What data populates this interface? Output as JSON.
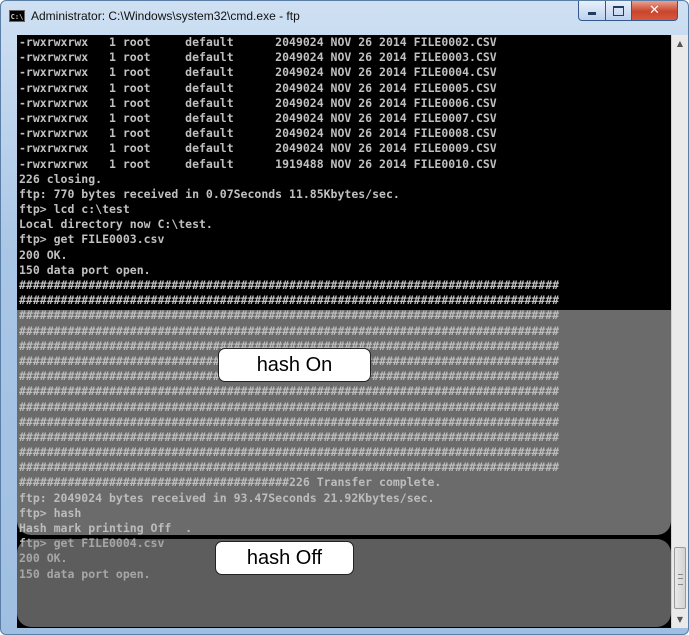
{
  "window": {
    "title": "Administrator: C:\\Windows\\system32\\cmd.exe - ftp",
    "icon": "cmd-icon",
    "controls": {
      "minimize": "minimize-icon",
      "maximize": "maximize-icon",
      "close": "close-icon"
    }
  },
  "console": {
    "text_color": "#c0c0c0",
    "background": "#000000",
    "lines": [
      "-rwxrwxrwx   1 root     default      2049024 NOV 26 2014 FILE0002.CSV",
      "-rwxrwxrwx   1 root     default      2049024 NOV 26 2014 FILE0003.CSV",
      "-rwxrwxrwx   1 root     default      2049024 NOV 26 2014 FILE0004.CSV",
      "-rwxrwxrwx   1 root     default      2049024 NOV 26 2014 FILE0005.CSV",
      "-rwxrwxrwx   1 root     default      2049024 NOV 26 2014 FILE0006.CSV",
      "-rwxrwxrwx   1 root     default      2049024 NOV 26 2014 FILE0007.CSV",
      "-rwxrwxrwx   1 root     default      2049024 NOV 26 2014 FILE0008.CSV",
      "-rwxrwxrwx   1 root     default      2049024 NOV 26 2014 FILE0009.CSV",
      "-rwxrwxrwx   1 root     default      1919488 NOV 26 2014 FILE0010.CSV",
      "226 closing.",
      "ftp: 770 bytes received in 0.07Seconds 11.85Kbytes/sec.",
      "ftp> lcd c:\\test",
      "Local directory now C:\\test.",
      "ftp> get FILE0003.csv",
      "200 OK.",
      "150 data port open.",
      "##############################################################################",
      "##############################################################################",
      "##############################################################################",
      "##############################################################################",
      "##############################################################################",
      "##############################################################################",
      "##############################################################################",
      "##############################################################################",
      "##############################################################################",
      "##############################################################################",
      "##############################################################################",
      "##############################################################################",
      "##############################################################################",
      "#######################################226 Transfer complete.",
      "ftp: 2049024 bytes received in 93.47Seconds 21.92Kbytes/sec.",
      "ftp> hash",
      "Hash mark printing Off  .",
      "ftp> get FILE0004.csv",
      "200 OK.",
      "150 data port open."
    ]
  },
  "annotations": {
    "hash_on": "hash On",
    "hash_off": "hash Off"
  },
  "scrollbar": {
    "up": "scroll-up-arrow-icon",
    "down": "scroll-down-arrow-icon",
    "position": 0.96
  }
}
